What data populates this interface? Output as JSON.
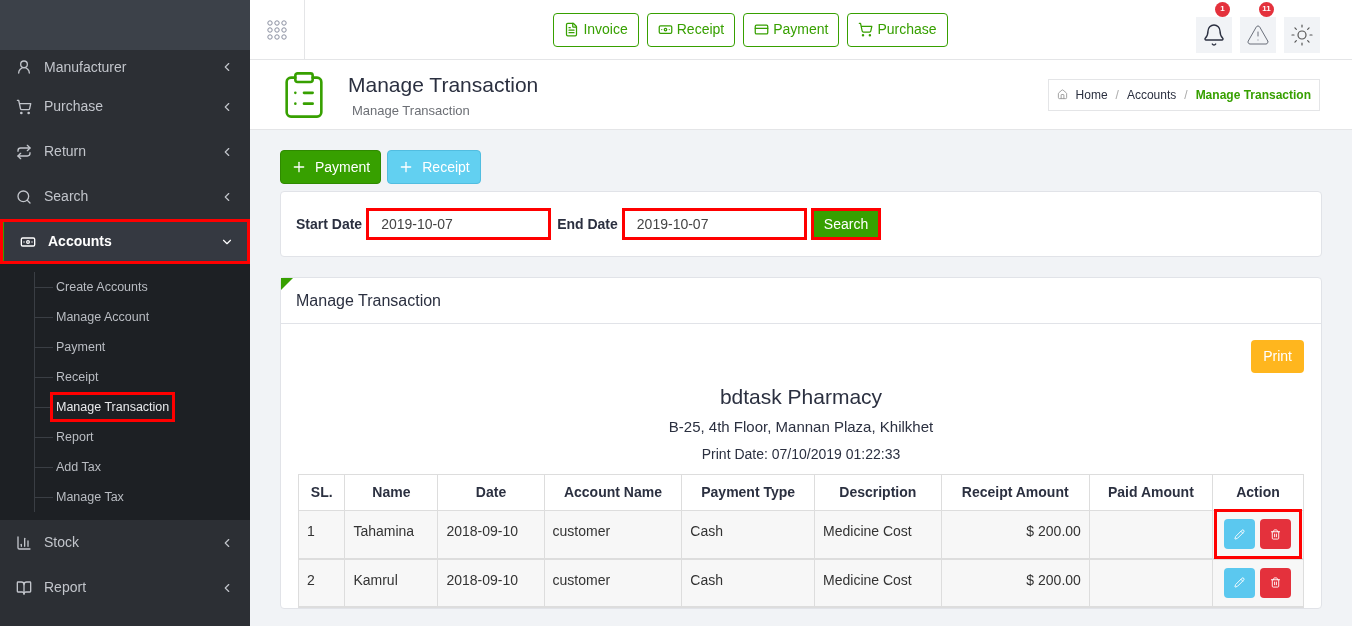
{
  "sidebar": {
    "menu": [
      {
        "label": "Manufacturer",
        "expanded": false,
        "annotated": false
      },
      {
        "label": "Purchase",
        "expanded": false,
        "annotated": false
      },
      {
        "label": "Return",
        "expanded": false,
        "annotated": false
      },
      {
        "label": "Search",
        "expanded": false,
        "annotated": false
      },
      {
        "label": "Accounts",
        "expanded": true,
        "annotated": true,
        "children": [
          {
            "label": "Create Accounts",
            "selected": false,
            "annotated": false
          },
          {
            "label": "Manage Account",
            "selected": false,
            "annotated": false
          },
          {
            "label": "Payment",
            "selected": false,
            "annotated": false
          },
          {
            "label": "Receipt",
            "selected": false,
            "annotated": false
          },
          {
            "label": "Manage Transaction",
            "selected": true,
            "annotated": true
          },
          {
            "label": "Report",
            "selected": false,
            "annotated": false
          },
          {
            "label": "Add Tax",
            "selected": false,
            "annotated": false
          },
          {
            "label": "Manage Tax",
            "selected": false,
            "annotated": false
          }
        ]
      },
      {
        "label": "Stock",
        "expanded": false,
        "annotated": false
      },
      {
        "label": "Report",
        "expanded": false,
        "annotated": false
      }
    ]
  },
  "toolbar": {
    "buttons": [
      "Invoice",
      "Receipt",
      "Payment",
      "Purchase"
    ],
    "notifications_badge": "1",
    "alerts_badge": "11"
  },
  "page_header": {
    "title": "Manage Transaction",
    "subtitle": "Manage Transaction",
    "separator": "/",
    "breadcrumb": [
      {
        "label": "Home",
        "selected": false
      },
      {
        "label": "Accounts",
        "selected": false
      },
      {
        "label": "Manage Transaction",
        "selected": true
      }
    ]
  },
  "actions": [
    {
      "label": "Payment",
      "kind": "success"
    },
    {
      "label": "Receipt",
      "kind": "info"
    }
  ],
  "filter": {
    "start_label": "Start Date",
    "start_value": "2019-10-07",
    "end_label": "End Date",
    "end_value": "2019-10-07",
    "search_button": "Search",
    "annotated": true
  },
  "panel": {
    "title": "Manage Transaction",
    "print_button": "Print",
    "company": "bdtask Pharmacy",
    "address": "B-25, 4th Floor, Mannan Plaza, Khilkhet",
    "print_date": "Print Date: 07/10/2019 01:22:33",
    "table": {
      "columns": [
        "SL.",
        "Name",
        "Date",
        "Account Name",
        "Payment Type",
        "Description",
        "Receipt Amount",
        "Paid Amount",
        "Action"
      ],
      "rows": [
        {
          "cells": [
            "1",
            "Tahamina",
            "2018-09-10",
            "customer",
            "Cash",
            "Medicine Cost",
            "$ 200.00",
            null
          ],
          "annotated": true
        },
        {
          "cells": [
            "2",
            "Kamrul",
            "2018-09-10",
            "customer",
            "Cash",
            "Medicine Cost",
            "$ 200.00",
            null
          ],
          "annotated": false
        }
      ]
    }
  }
}
